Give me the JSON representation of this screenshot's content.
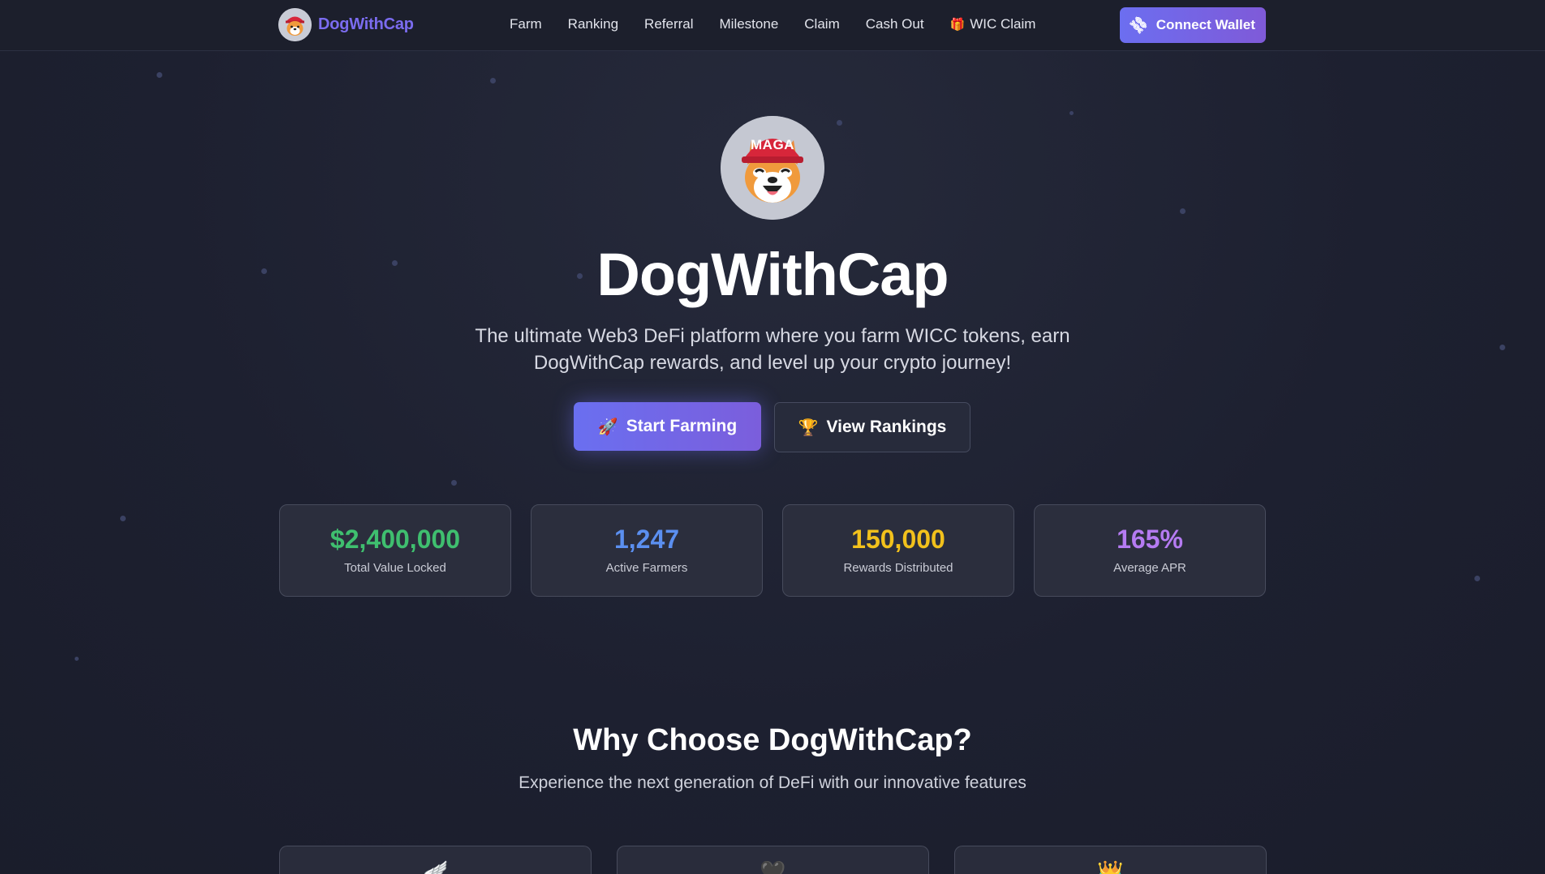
{
  "nav": {
    "brand": "DogWithCap",
    "links": [
      "Farm",
      "Ranking",
      "Referral",
      "Milestone",
      "Claim",
      "Cash Out"
    ],
    "wic_claim": "WIC Claim",
    "connect_label": "Connect Wallet",
    "connect_icon": "link-icon"
  },
  "hero": {
    "avatar_badge": "MAGA",
    "title": "DogWithCap",
    "subtitle": "The ultimate Web3 DeFi platform where you farm WICC tokens, earn DogWithCap rewards, and level up your crypto journey!",
    "primary_cta": "Start Farming",
    "primary_icon": "rocket-icon",
    "secondary_cta": "View Rankings",
    "secondary_icon": "trophy-icon"
  },
  "stats": [
    {
      "value": "$2,400,000",
      "label": "Total Value Locked",
      "color": "#3fbf6f"
    },
    {
      "value": "1,247",
      "label": "Active Farmers",
      "color": "#5b8ff0"
    },
    {
      "value": "150,000",
      "label": "Rewards Distributed",
      "color": "#f2c11c"
    },
    {
      "value": "165%",
      "label": "Average APR",
      "color": "#b57bf2"
    }
  ],
  "features": {
    "title": "Why Choose DogWithCap?",
    "subtitle": "Experience the next generation of DeFi with our innovative features",
    "card_icons": [
      "wing-icon",
      "heart-icon",
      "crown-icon"
    ]
  },
  "colors": {
    "background": "#1d2030",
    "accent": "#6c6ef0",
    "brand_text": "#7b6cf0"
  }
}
